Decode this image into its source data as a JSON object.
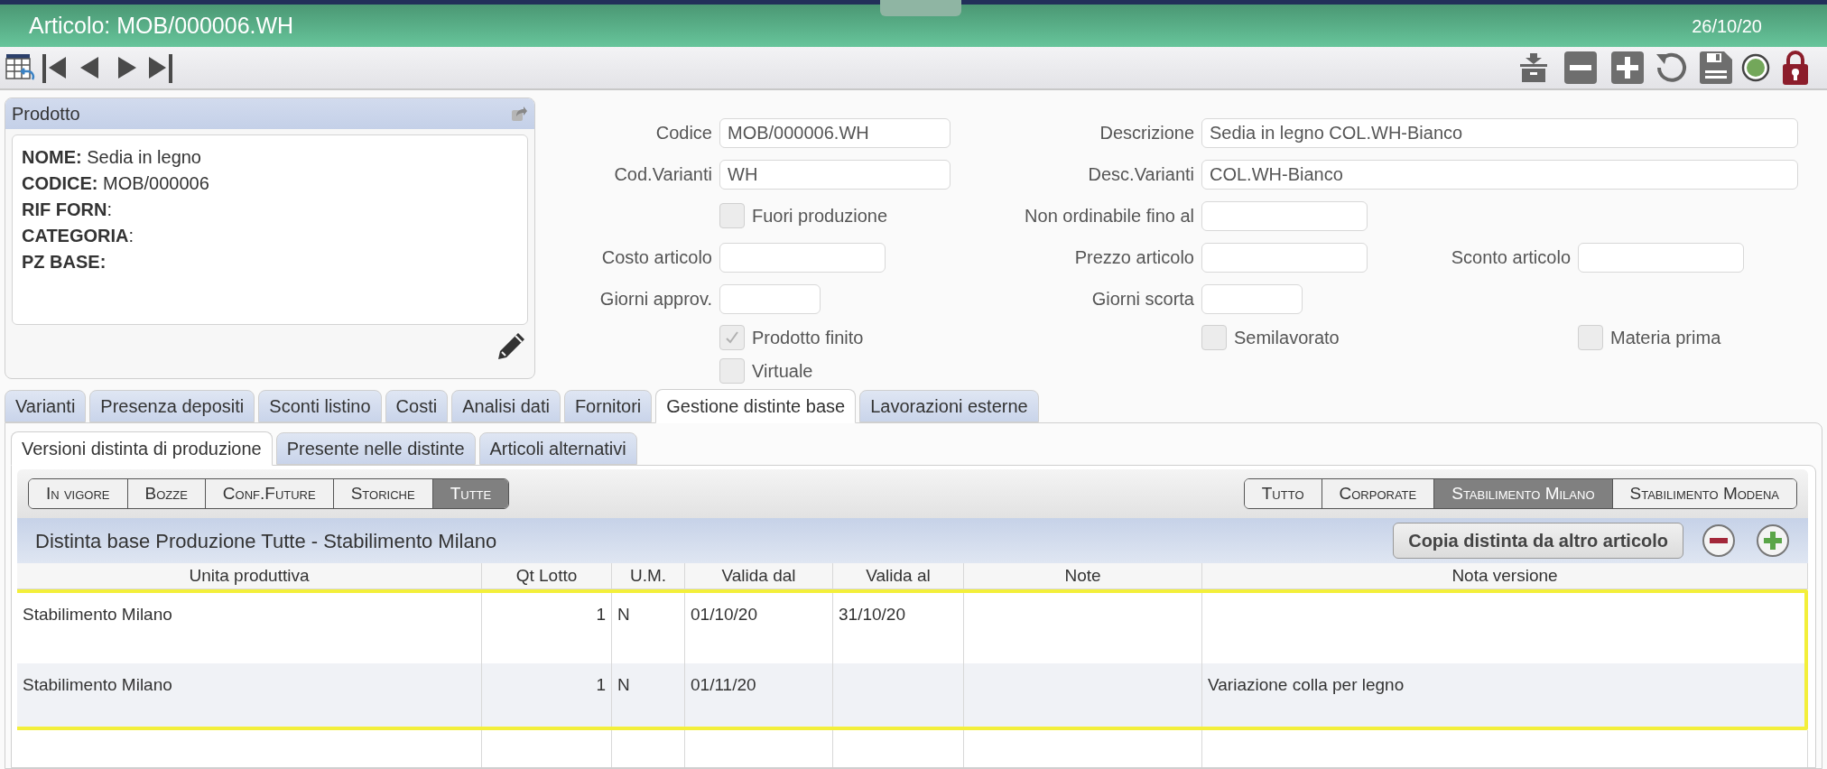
{
  "window": {
    "title": "Articolo: MOB/000006.WH",
    "date": "26/10/20"
  },
  "product_card": {
    "title": "Prodotto",
    "lines": [
      "**NOME:** Sedia in legno",
      "**CODICE:** MOB/000006",
      "**RIF FORN**:",
      "**CATEGORIA**:",
      "**PZ BASE:**"
    ]
  },
  "form": {
    "rows": [
      [
        {
          "kind": "code",
          "label": "Codice",
          "value": "MOB/000006.WH"
        },
        {
          "kind": "wide",
          "label": "Descrizione",
          "value": "Sedia in legno COL.WH-Bianco"
        },
        null
      ],
      [
        {
          "kind": "code",
          "label": "Cod.Varianti",
          "value": "WH"
        },
        {
          "kind": "wide",
          "label": "Desc.Varianti",
          "value": "COL.WH-Bianco"
        },
        null
      ],
      [
        {
          "kind": "checkbox",
          "label": "Fuori produzione",
          "checked": false
        },
        {
          "kind": "date",
          "label": "Non ordinabile fino al"
        },
        null
      ],
      [
        {
          "kind": "amount",
          "label": "Costo articolo"
        },
        {
          "kind": "amount",
          "label": "Prezzo articolo"
        },
        {
          "kind": "amount",
          "label": "Sconto articolo"
        }
      ],
      [
        {
          "kind": "days",
          "label": "Giorni approv."
        },
        {
          "kind": "days",
          "label": "Giorni scorta"
        },
        null
      ],
      [
        {
          "kind": "checkbox",
          "label": "Prodotto finito",
          "checked": true
        },
        {
          "kind": "checkbox",
          "label": "Semilavorato",
          "checked": false
        },
        {
          "kind": "checkbox",
          "label": "Materia prima",
          "checked": false
        }
      ],
      [
        {
          "kind": "checkbox",
          "label": "Virtuale",
          "checked": false
        },
        null,
        null
      ]
    ]
  },
  "tabs": [
    {
      "label": "Varianti",
      "selected": false
    },
    {
      "label": "Presenza depositi",
      "selected": false
    },
    {
      "label": "Sconti listino",
      "selected": false
    },
    {
      "label": "Costi",
      "selected": false
    },
    {
      "label": "Analisi dati",
      "selected": false
    },
    {
      "label": "Fornitori",
      "selected": false
    },
    {
      "label": "Gestione distinte base",
      "selected": true
    },
    {
      "label": "Lavorazioni esterne",
      "selected": false
    }
  ],
  "subtabs": [
    {
      "label": "Versioni distinta di produzione",
      "selected": true
    },
    {
      "label": "Presente nelle distinte",
      "selected": false
    },
    {
      "label": "Articoli alternativi",
      "selected": false
    }
  ],
  "status_filters": [
    {
      "label": "In vigore",
      "selected": false
    },
    {
      "label": "Bozze",
      "selected": false
    },
    {
      "label": "Conf.Future",
      "selected": false
    },
    {
      "label": "Storiche",
      "selected": false
    },
    {
      "label": "Tutte",
      "selected": true
    }
  ],
  "site_filters": [
    {
      "label": "Tutto",
      "selected": false
    },
    {
      "label": "Corporate",
      "selected": false
    },
    {
      "label": "Stabilimento Milano",
      "selected": true
    },
    {
      "label": "Stabilimento Modena",
      "selected": false
    }
  ],
  "grid": {
    "title": "Distinta base Produzione Tutte - Stabilimento Milano",
    "copy_button": "Copia distinta da altro articolo",
    "columns": [
      "Unita produttiva",
      "Qt Lotto",
      "U.M.",
      "Valida dal",
      "Valida al",
      "Note",
      "Nota versione"
    ],
    "rows": [
      [
        "Stabilimento Milano",
        "1",
        "N",
        "01/10/20",
        "31/10/20",
        null,
        null
      ],
      [
        "Stabilimento Milano",
        "1",
        "N",
        "01/11/20",
        null,
        null,
        "Variazione colla per legno"
      ]
    ]
  }
}
